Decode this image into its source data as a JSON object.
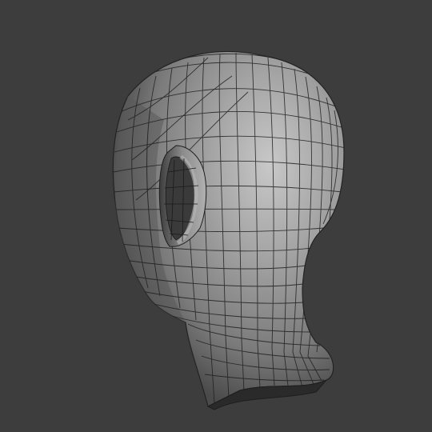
{
  "viewport": {
    "background": "#3d3d3d",
    "mesh": {
      "name": "head-mesh",
      "shading": "solid",
      "overlay": "wireframe",
      "parts": [
        "head",
        "ear",
        "neck"
      ],
      "colors": {
        "surface_light": "#bdbdbd",
        "surface_mid": "#8a8a8a",
        "surface_dark": "#4e4e4e",
        "wire": "#1e1e1e"
      }
    }
  }
}
